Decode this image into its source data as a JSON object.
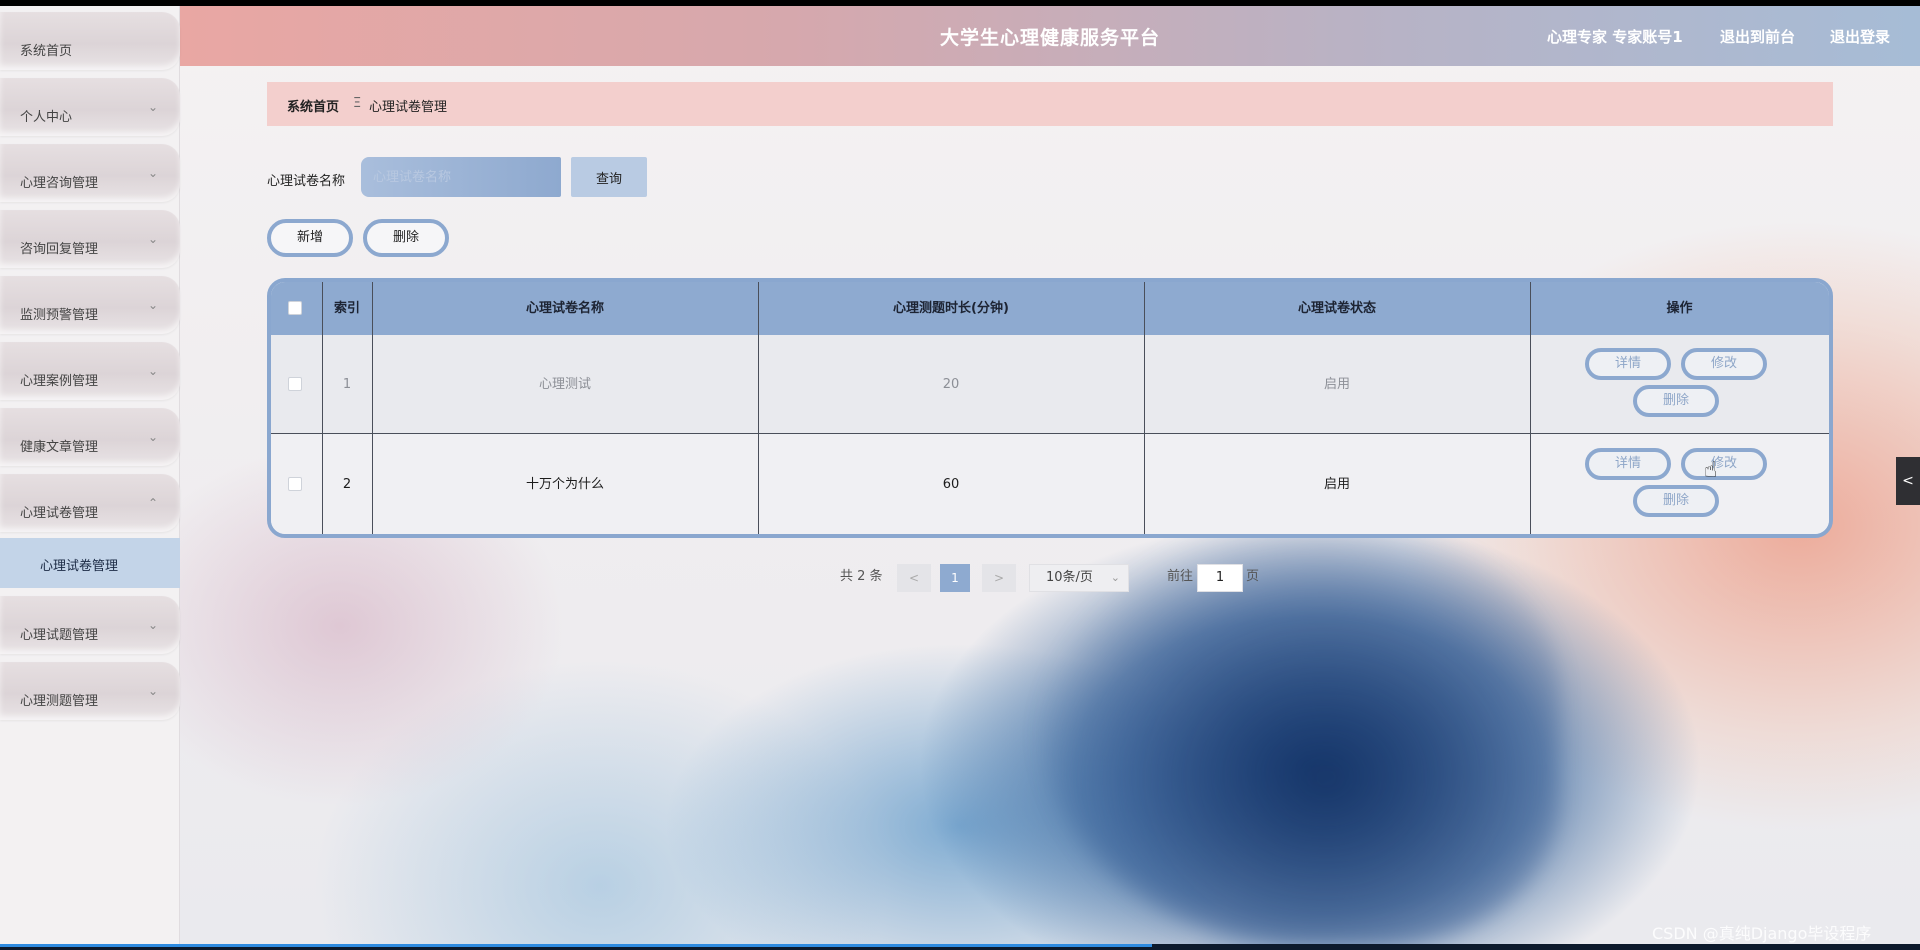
{
  "header": {
    "title": "大学生心理健康服务平台",
    "user": "心理专家 专家账号1",
    "to_front": "退出到前台",
    "logout": "退出登录"
  },
  "sidebar": {
    "items": [
      {
        "label": "系统首页",
        "has_chevron": false
      },
      {
        "label": "个人中心",
        "has_chevron": true
      },
      {
        "label": "心理咨询管理",
        "has_chevron": true
      },
      {
        "label": "咨询回复管理",
        "has_chevron": true
      },
      {
        "label": "监测预警管理",
        "has_chevron": true
      },
      {
        "label": "心理案例管理",
        "has_chevron": true
      },
      {
        "label": "健康文章管理",
        "has_chevron": true
      },
      {
        "label": "心理试卷管理",
        "has_chevron": true,
        "expanded": true
      },
      {
        "label": "心理试题管理",
        "has_chevron": true
      },
      {
        "label": "心理测题管理",
        "has_chevron": true
      }
    ],
    "sub_item": "心理试卷管理"
  },
  "breadcrumb": {
    "home": "系统首页",
    "separator": "Ξ",
    "current": "心理试卷管理"
  },
  "search": {
    "label": "心理试卷名称",
    "placeholder": "心理试卷名称",
    "query_button": "查询"
  },
  "actions": {
    "add": "新增",
    "delete": "删除"
  },
  "table": {
    "headers": [
      "索引",
      "心理试卷名称",
      "心理测题时长(分钟)",
      "心理试卷状态",
      "操作"
    ],
    "rows": [
      {
        "index": "1",
        "name": "心理测试",
        "duration": "20",
        "status": "启用"
      },
      {
        "index": "2",
        "name": "十万个为什么",
        "duration": "60",
        "status": "启用"
      }
    ],
    "op_buttons": {
      "detail": "详情",
      "edit": "修改",
      "delete": "删除"
    }
  },
  "pagination": {
    "total": "共 2 条",
    "prev": "<",
    "current_page": "1",
    "next": ">",
    "page_size": "10条/页",
    "goto_label": "前往",
    "goto_value": "1",
    "page_suffix": "页"
  },
  "side_tab": "<",
  "watermark": "CSDN @真纯Django毕设程序",
  "colors": {
    "accent": "#8eaad0",
    "header_start": "#e9a7a3",
    "header_end": "#a6bcd6",
    "breadcrumb_bg": "#f3cfcd"
  },
  "video_progress": 0.6
}
